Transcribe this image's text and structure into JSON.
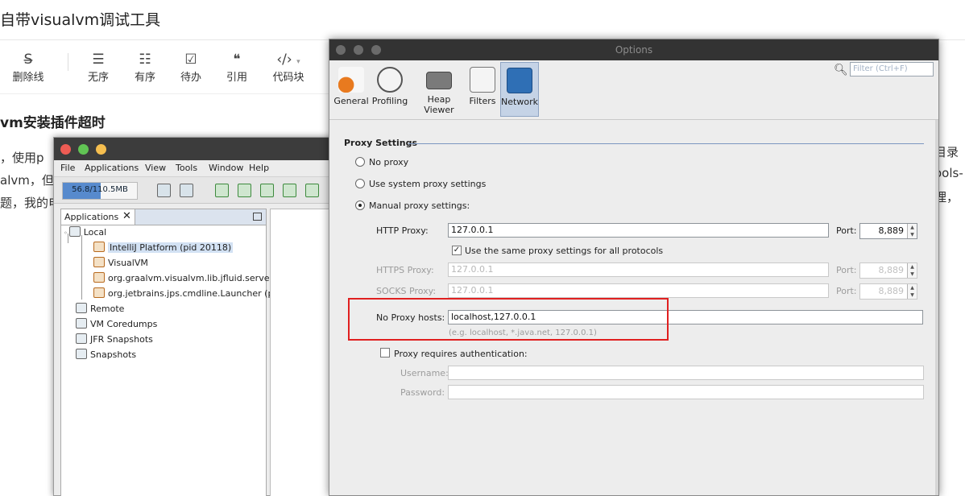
{
  "bg": {
    "title": "自带visualvm调试工具",
    "toolbar": [
      {
        "icon": "strike-icon",
        "glyph": "S̶",
        "label": "删除线"
      },
      {
        "icon": "unordered-list-icon",
        "glyph": "☰",
        "label": "无序"
      },
      {
        "icon": "ordered-list-icon",
        "glyph": "☷",
        "label": "有序"
      },
      {
        "icon": "todo-list-icon",
        "glyph": "☑",
        "label": "待办"
      },
      {
        "icon": "quote-icon",
        "glyph": "❝",
        "label": "引用"
      },
      {
        "icon": "code-block-icon",
        "glyph": "‹/›",
        "label": "代码块"
      }
    ],
    "heading": "vm安装插件超时",
    "text_lines": [
      "，使用p",
      "alvm，但是",
      "题，我的电"
    ],
    "right_lines": [
      "目录",
      "ools-",
      "理，"
    ]
  },
  "vvm": {
    "menu": [
      "File",
      "Applications",
      "View",
      "Tools",
      "Window",
      "Help"
    ],
    "memory": "56.8/110.5MB",
    "memory_fraction": 0.51,
    "apps_tab": "Applications",
    "tree": {
      "local": "Local",
      "apps": [
        {
          "label": "IntelliJ Platform (pid 20118)",
          "selected": true
        },
        {
          "label": "VisualVM",
          "selected": false
        },
        {
          "label": "org.graalvm.visualvm.lib.jfluid.server.Pr",
          "selected": false
        },
        {
          "label": "org.jetbrains.jps.cmdline.Launcher (pid",
          "selected": false
        }
      ],
      "remote": "Remote",
      "coredumps": "VM Coredumps",
      "jfr": "JFR Snapshots",
      "snapshots": "Snapshots"
    }
  },
  "options": {
    "title": "Options",
    "categories": [
      "General",
      "Profiling",
      "Heap Viewer",
      "Filters",
      "Network"
    ],
    "active_category": "Network",
    "filter_placeholder": "Filter (Ctrl+F)",
    "proxy_section": "Proxy Settings",
    "radio": {
      "no_proxy": "No proxy",
      "system": "Use system proxy settings",
      "manual": "Manual proxy settings:"
    },
    "http": {
      "label": "HTTP Proxy:",
      "value": "127.0.0.1",
      "port_label": "Port:",
      "port": "8,889"
    },
    "same_proxy": "Use the same proxy settings for all protocols",
    "https": {
      "label": "HTTPS Proxy:",
      "value": "127.0.0.1",
      "port_label": "Port:",
      "port": "8,889"
    },
    "socks": {
      "label": "SOCKS Proxy:",
      "value": "127.0.0.1",
      "port_label": "Port:",
      "port": "8,889"
    },
    "no_proxy_hosts": {
      "label": "No Proxy hosts:",
      "value": "localhost,127.0.0.1",
      "hint": "(e.g. localhost, *.java.net, 127.0.0.1)"
    },
    "auth": {
      "label": "Proxy requires authentication:",
      "username": "Username:",
      "password": "Password:"
    }
  },
  "colors": {
    "highlight": "#e02020",
    "accent": "#3b77c6",
    "selection": "#c5d3e6"
  }
}
